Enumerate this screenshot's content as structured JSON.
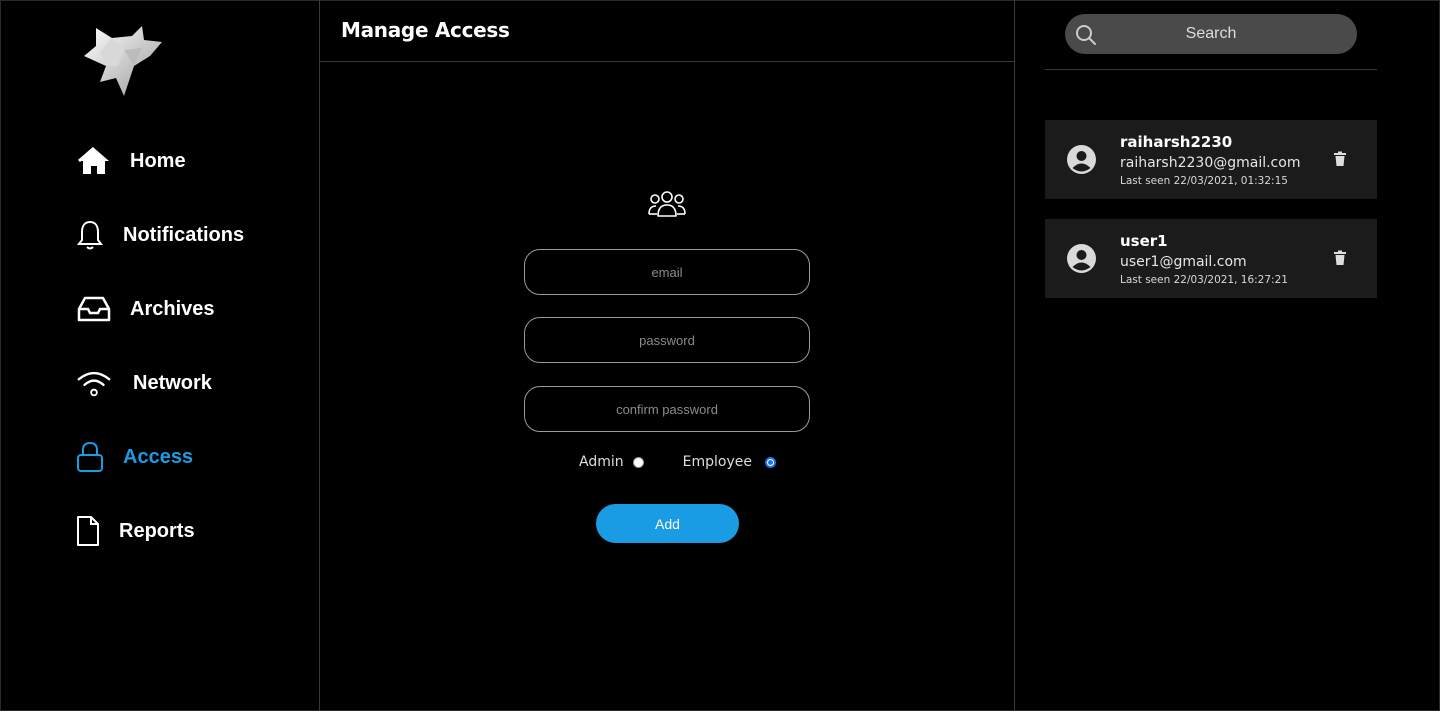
{
  "sidebar": {
    "items": [
      {
        "label": "Home",
        "icon": "home-icon"
      },
      {
        "label": "Notifications",
        "icon": "bell-icon"
      },
      {
        "label": "Archives",
        "icon": "inbox-icon"
      },
      {
        "label": "Network",
        "icon": "wifi-icon"
      },
      {
        "label": "Access",
        "icon": "lock-icon",
        "active": true
      },
      {
        "label": "Reports",
        "icon": "document-icon"
      }
    ]
  },
  "main": {
    "title": "Manage Access",
    "form": {
      "email_placeholder": "email",
      "password_placeholder": "password",
      "confirm_placeholder": "confirm password",
      "roles": [
        {
          "label": "Admin",
          "checked": false
        },
        {
          "label": "Employee",
          "checked": true
        }
      ],
      "add_label": "Add"
    }
  },
  "search": {
    "placeholder": "Search"
  },
  "users": [
    {
      "name": "raiharsh2230",
      "email": "raiharsh2230@gmail.com",
      "last_seen": "Last seen 22/03/2021, 01:32:15"
    },
    {
      "name": "user1",
      "email": "user1@gmail.com",
      "last_seen": "Last seen 22/03/2021, 16:27:21"
    }
  ],
  "colors": {
    "accent": "#1a9ce4",
    "background": "#000000",
    "card": "#1b1b1b",
    "search_bg": "#4a4a4a"
  }
}
